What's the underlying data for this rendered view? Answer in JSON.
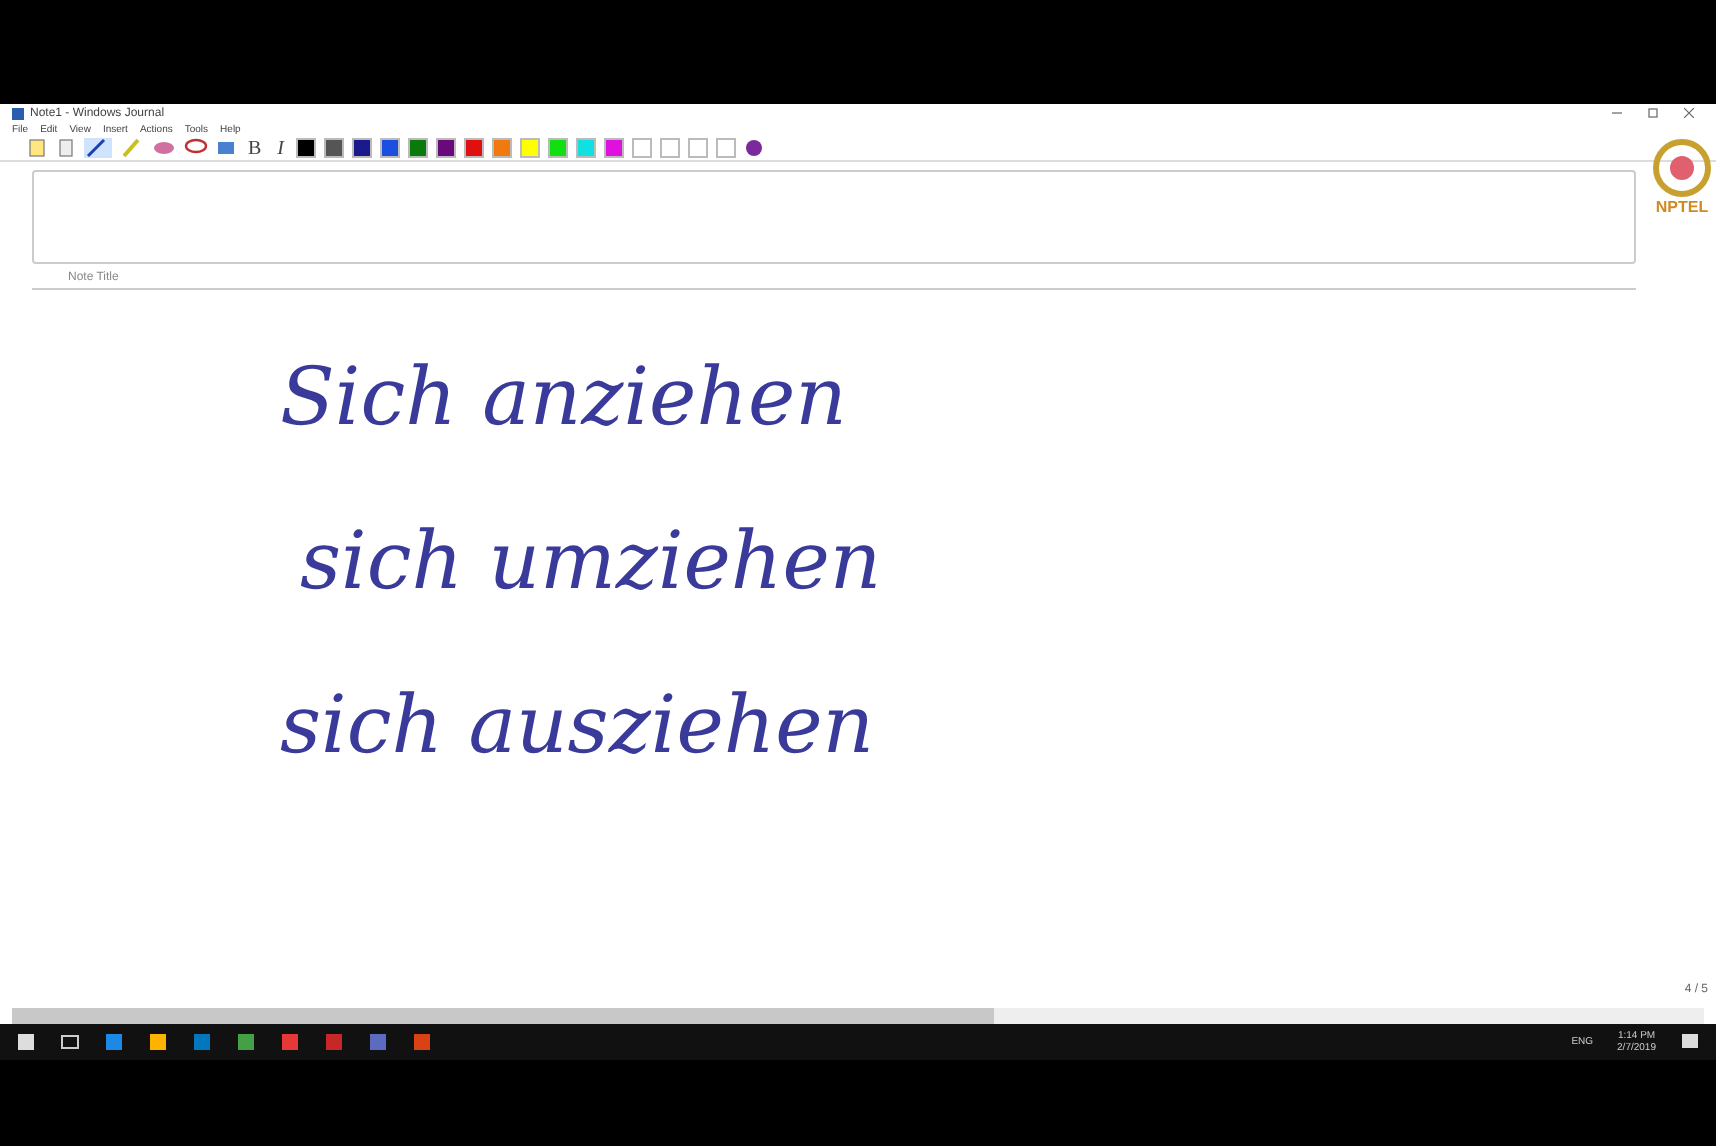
{
  "window": {
    "title": "Note1 - Windows Journal"
  },
  "menu": [
    "File",
    "Edit",
    "View",
    "Insert",
    "Actions",
    "Tools",
    "Help"
  ],
  "toolbar": {
    "bold": "B",
    "italic": "I",
    "swatches": [
      {
        "color": "#000000"
      },
      {
        "color": "#555555"
      },
      {
        "color": "#1a1a8c"
      },
      {
        "color": "#1a4fe0"
      },
      {
        "color": "#0a7a0a"
      },
      {
        "color": "#6a0a7a"
      },
      {
        "color": "#e01010"
      },
      {
        "color": "#f07a10"
      },
      {
        "color": "#ffff00"
      },
      {
        "color": "#10e010"
      },
      {
        "color": "#10e0e0"
      },
      {
        "color": "#e010e0"
      },
      {
        "color": "#ffffff"
      },
      {
        "color": "#ffffff"
      },
      {
        "color": "#ffffff"
      },
      {
        "color": "#ffffff"
      }
    ]
  },
  "logo": {
    "text": "NPTEL"
  },
  "note": {
    "title_label": "Note Title",
    "lines": [
      "Sich anziehen",
      "sich umziehen",
      "sich ausziehen"
    ]
  },
  "page_indicator": "4 / 5",
  "taskbar": {
    "language": "ENG",
    "time": "1:14 PM",
    "date": "2/7/2019"
  }
}
